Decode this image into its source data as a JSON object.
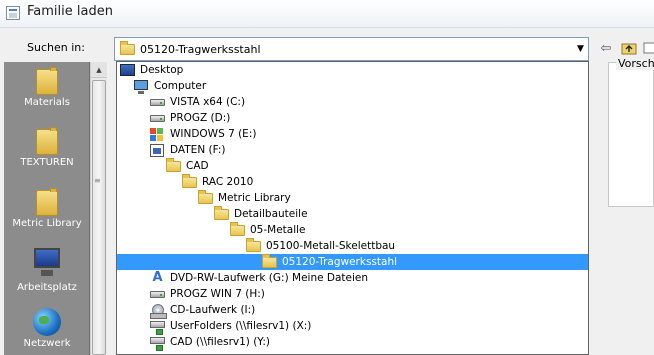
{
  "window": {
    "title": "Familie laden"
  },
  "lookin": {
    "label": "Suchen in:",
    "value": "05120-Tragwerksstahl"
  },
  "toolbar": {
    "back_icon": "back-arrow-icon",
    "up_icon": "up-folder-icon",
    "more_icon": "more-icon"
  },
  "places": [
    {
      "label": "Materials",
      "icon": "folder-icon"
    },
    {
      "label": "TEXTUREN",
      "icon": "folder-icon"
    },
    {
      "label": "Metric Library",
      "icon": "folder-icon"
    },
    {
      "label": "Arbeitsplatz",
      "icon": "computer-icon"
    },
    {
      "label": "Netzwerk",
      "icon": "network-icon"
    }
  ],
  "dropdown": {
    "items": [
      {
        "label": "Desktop",
        "icon": "desktop-icon"
      },
      {
        "label": "Computer",
        "icon": "computer-icon"
      },
      {
        "label": "VISTA x64 (C:)",
        "icon": "drive-icon"
      },
      {
        "label": "PROGZ (D:)",
        "icon": "drive-icon"
      },
      {
        "label": "WINDOWS 7 (E:)",
        "icon": "windows-drive-icon"
      },
      {
        "label": "DATEN (F:)",
        "icon": "data-drive-icon"
      },
      {
        "label": "CAD",
        "icon": "folder-icon"
      },
      {
        "label": "RAC 2010",
        "icon": "folder-icon"
      },
      {
        "label": "Metric Library",
        "icon": "folder-icon"
      },
      {
        "label": "Detailbauteile",
        "icon": "folder-icon"
      },
      {
        "label": "05-Metalle",
        "icon": "folder-icon"
      },
      {
        "label": "05100-Metall-Skelettbau",
        "icon": "folder-icon"
      },
      {
        "label": "05120-Tragwerksstahl",
        "icon": "folder-icon",
        "selected": true
      },
      {
        "label": "DVD-RW-Laufwerk (G:) Meine Dateien",
        "icon": "dvd-icon"
      },
      {
        "label": "PROGZ WIN 7 (H:)",
        "icon": "drive-icon"
      },
      {
        "label": "CD-Laufwerk (I:)",
        "icon": "cd-icon"
      },
      {
        "label": "UserFolders (\\\\filesrv1) (X:)",
        "icon": "network-drive-icon"
      },
      {
        "label": "CAD (\\\\filesrv1) (Y:)",
        "icon": "network-drive-icon"
      }
    ]
  },
  "preview": {
    "label": "Vorscha"
  },
  "colors": {
    "selection": "#3399ff",
    "places_bg": "#8c8c8c"
  }
}
